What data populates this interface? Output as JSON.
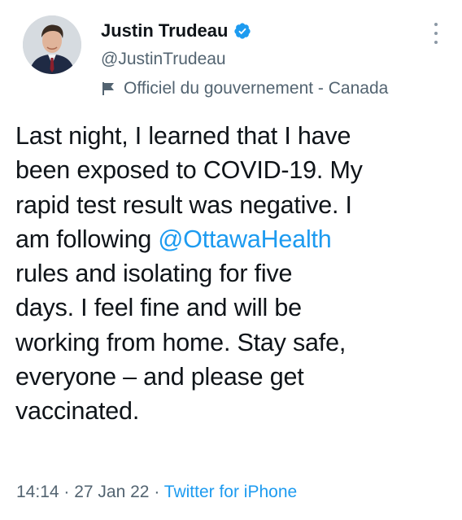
{
  "author": {
    "display_name": "Justin Trudeau",
    "handle": "@JustinTrudeau",
    "label": "Officiel du gouvernement - Canada",
    "verified_icon": "verified-badge-icon",
    "label_icon": "government-flag-icon"
  },
  "tweet": {
    "lines": [
      "Last night, I learned that I have",
      "been exposed to COVID-19. My",
      "rapid test result was negative. I",
      "am following ",
      "rules and isolating for five",
      "days. I feel fine and will be",
      "working from home. Stay safe,",
      "everyone – and please get",
      "vaccinated."
    ],
    "mention": "@OttawaHealth"
  },
  "meta": {
    "time": "14:14",
    "sep1": " · ",
    "date": "27 Jan 22",
    "sep2": " · ",
    "source": "Twitter for iPhone"
  },
  "colors": {
    "accent": "#1d9bf0",
    "text": "#0f1419",
    "secondary": "#536471"
  }
}
